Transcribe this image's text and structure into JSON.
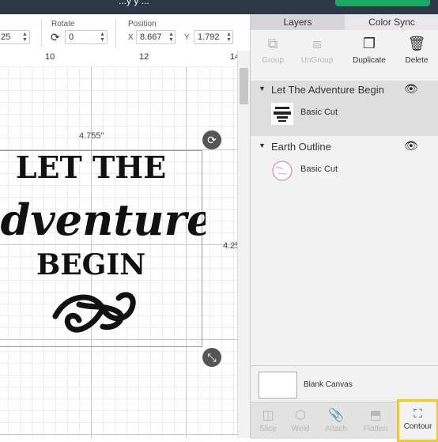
{
  "header": {
    "title": "...y  y ..."
  },
  "toolbar": {
    "size_value": "25",
    "rotate_label": "Rotate",
    "rotate_value": "0",
    "position_label": "Position",
    "x_label": "X",
    "x_value": "8.667",
    "y_label": "Y",
    "y_value": "1.792"
  },
  "ruler": {
    "marks": [
      "10",
      "12",
      "14"
    ]
  },
  "canvas": {
    "width_dim": "4.755\"",
    "height_dim": "4.25",
    "art_lines": [
      "LET THE",
      "adventure",
      "BEGIN"
    ]
  },
  "panel": {
    "tabs": [
      {
        "label": "Layers"
      },
      {
        "label": "Color Sync"
      }
    ],
    "tools": [
      {
        "label": "Group",
        "icon": "group-icon"
      },
      {
        "label": "UnGroup",
        "icon": "ungroup-icon"
      },
      {
        "label": "Duplicate",
        "icon": "duplicate-icon"
      },
      {
        "label": "Delete",
        "icon": "trash-icon"
      }
    ],
    "layers": [
      {
        "name": "Let The Adventure Begin",
        "child": "Basic Cut"
      },
      {
        "name": "Earth Outline",
        "child": "Basic Cut"
      }
    ],
    "blank_canvas": "Blank Canvas",
    "bottom_tools": [
      {
        "label": "Slice",
        "icon": "slice-icon"
      },
      {
        "label": "Weld",
        "icon": "weld-icon"
      },
      {
        "label": "Attach",
        "icon": "attach-icon"
      },
      {
        "label": "Flatten",
        "icon": "flatten-icon"
      },
      {
        "label": "Contour",
        "icon": "contour-icon"
      }
    ]
  },
  "colors": {
    "accent": "#1aa860",
    "highlight": "#f6c915"
  }
}
